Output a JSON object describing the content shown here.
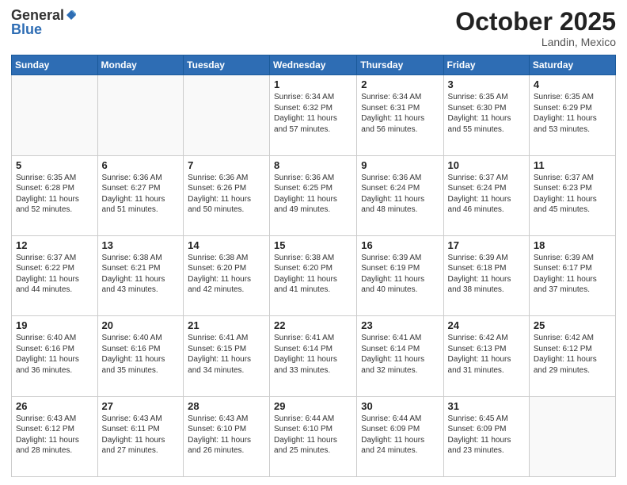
{
  "header": {
    "logo_general": "General",
    "logo_blue": "Blue",
    "month_title": "October 2025",
    "location": "Landin, Mexico"
  },
  "days_of_week": [
    "Sunday",
    "Monday",
    "Tuesday",
    "Wednesday",
    "Thursday",
    "Friday",
    "Saturday"
  ],
  "weeks": [
    [
      {
        "day": "",
        "info": ""
      },
      {
        "day": "",
        "info": ""
      },
      {
        "day": "",
        "info": ""
      },
      {
        "day": "1",
        "info": "Sunrise: 6:34 AM\nSunset: 6:32 PM\nDaylight: 11 hours and 57 minutes."
      },
      {
        "day": "2",
        "info": "Sunrise: 6:34 AM\nSunset: 6:31 PM\nDaylight: 11 hours and 56 minutes."
      },
      {
        "day": "3",
        "info": "Sunrise: 6:35 AM\nSunset: 6:30 PM\nDaylight: 11 hours and 55 minutes."
      },
      {
        "day": "4",
        "info": "Sunrise: 6:35 AM\nSunset: 6:29 PM\nDaylight: 11 hours and 53 minutes."
      }
    ],
    [
      {
        "day": "5",
        "info": "Sunrise: 6:35 AM\nSunset: 6:28 PM\nDaylight: 11 hours and 52 minutes."
      },
      {
        "day": "6",
        "info": "Sunrise: 6:36 AM\nSunset: 6:27 PM\nDaylight: 11 hours and 51 minutes."
      },
      {
        "day": "7",
        "info": "Sunrise: 6:36 AM\nSunset: 6:26 PM\nDaylight: 11 hours and 50 minutes."
      },
      {
        "day": "8",
        "info": "Sunrise: 6:36 AM\nSunset: 6:25 PM\nDaylight: 11 hours and 49 minutes."
      },
      {
        "day": "9",
        "info": "Sunrise: 6:36 AM\nSunset: 6:24 PM\nDaylight: 11 hours and 48 minutes."
      },
      {
        "day": "10",
        "info": "Sunrise: 6:37 AM\nSunset: 6:24 PM\nDaylight: 11 hours and 46 minutes."
      },
      {
        "day": "11",
        "info": "Sunrise: 6:37 AM\nSunset: 6:23 PM\nDaylight: 11 hours and 45 minutes."
      }
    ],
    [
      {
        "day": "12",
        "info": "Sunrise: 6:37 AM\nSunset: 6:22 PM\nDaylight: 11 hours and 44 minutes."
      },
      {
        "day": "13",
        "info": "Sunrise: 6:38 AM\nSunset: 6:21 PM\nDaylight: 11 hours and 43 minutes."
      },
      {
        "day": "14",
        "info": "Sunrise: 6:38 AM\nSunset: 6:20 PM\nDaylight: 11 hours and 42 minutes."
      },
      {
        "day": "15",
        "info": "Sunrise: 6:38 AM\nSunset: 6:20 PM\nDaylight: 11 hours and 41 minutes."
      },
      {
        "day": "16",
        "info": "Sunrise: 6:39 AM\nSunset: 6:19 PM\nDaylight: 11 hours and 40 minutes."
      },
      {
        "day": "17",
        "info": "Sunrise: 6:39 AM\nSunset: 6:18 PM\nDaylight: 11 hours and 38 minutes."
      },
      {
        "day": "18",
        "info": "Sunrise: 6:39 AM\nSunset: 6:17 PM\nDaylight: 11 hours and 37 minutes."
      }
    ],
    [
      {
        "day": "19",
        "info": "Sunrise: 6:40 AM\nSunset: 6:16 PM\nDaylight: 11 hours and 36 minutes."
      },
      {
        "day": "20",
        "info": "Sunrise: 6:40 AM\nSunset: 6:16 PM\nDaylight: 11 hours and 35 minutes."
      },
      {
        "day": "21",
        "info": "Sunrise: 6:41 AM\nSunset: 6:15 PM\nDaylight: 11 hours and 34 minutes."
      },
      {
        "day": "22",
        "info": "Sunrise: 6:41 AM\nSunset: 6:14 PM\nDaylight: 11 hours and 33 minutes."
      },
      {
        "day": "23",
        "info": "Sunrise: 6:41 AM\nSunset: 6:14 PM\nDaylight: 11 hours and 32 minutes."
      },
      {
        "day": "24",
        "info": "Sunrise: 6:42 AM\nSunset: 6:13 PM\nDaylight: 11 hours and 31 minutes."
      },
      {
        "day": "25",
        "info": "Sunrise: 6:42 AM\nSunset: 6:12 PM\nDaylight: 11 hours and 29 minutes."
      }
    ],
    [
      {
        "day": "26",
        "info": "Sunrise: 6:43 AM\nSunset: 6:12 PM\nDaylight: 11 hours and 28 minutes."
      },
      {
        "day": "27",
        "info": "Sunrise: 6:43 AM\nSunset: 6:11 PM\nDaylight: 11 hours and 27 minutes."
      },
      {
        "day": "28",
        "info": "Sunrise: 6:43 AM\nSunset: 6:10 PM\nDaylight: 11 hours and 26 minutes."
      },
      {
        "day": "29",
        "info": "Sunrise: 6:44 AM\nSunset: 6:10 PM\nDaylight: 11 hours and 25 minutes."
      },
      {
        "day": "30",
        "info": "Sunrise: 6:44 AM\nSunset: 6:09 PM\nDaylight: 11 hours and 24 minutes."
      },
      {
        "day": "31",
        "info": "Sunrise: 6:45 AM\nSunset: 6:09 PM\nDaylight: 11 hours and 23 minutes."
      },
      {
        "day": "",
        "info": ""
      }
    ]
  ]
}
